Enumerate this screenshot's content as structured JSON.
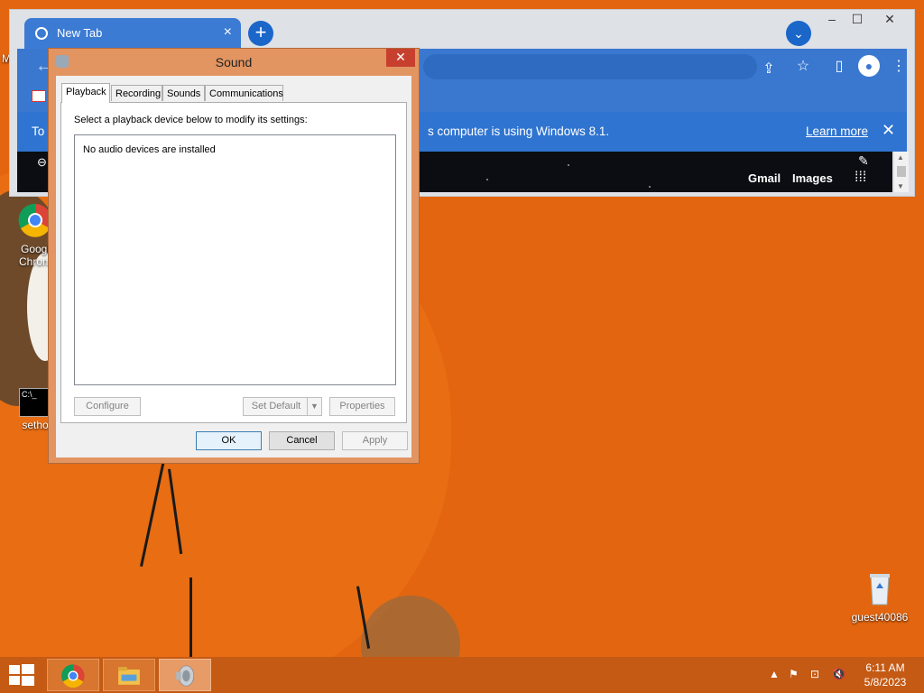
{
  "desktop": {
    "icons": [
      {
        "label": "Google Chrome",
        "line1": "Googl",
        "line2": "Chrom"
      },
      {
        "label": "setho",
        "line1": "setho"
      },
      {
        "label": "guest40086",
        "line1": "guest40086"
      }
    ],
    "edge_letter": "M"
  },
  "chrome": {
    "tab_title": "New Tab",
    "infobar": {
      "left_text": "To",
      "message": "s computer is using Windows 8.1.",
      "learn_more": "Learn more"
    },
    "page": {
      "links": [
        "Gmail",
        "Images"
      ]
    },
    "window_controls": {
      "minimize": "–",
      "maximize": "☐",
      "close": "✕"
    }
  },
  "dialog": {
    "title": "Sound",
    "tabs": [
      "Playback",
      "Recording",
      "Sounds",
      "Communications"
    ],
    "active_tab": "Playback",
    "instruction": "Select a playback device below to modify its settings:",
    "empty_list": "No audio devices are installed",
    "buttons": {
      "configure": "Configure",
      "set_default": "Set Default",
      "properties": "Properties",
      "ok": "OK",
      "cancel": "Cancel",
      "apply": "Apply"
    }
  },
  "taskbar": {
    "time": "6:11 AM",
    "date": "5/8/2023"
  },
  "colors": {
    "desktop": "#e3650f",
    "chrome_accent": "#3a78d0",
    "dialog_frame": "#e29461",
    "taskbar": "#c45a14"
  }
}
